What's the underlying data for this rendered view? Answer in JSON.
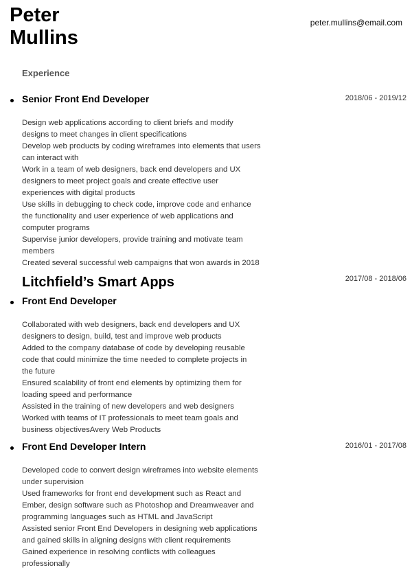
{
  "header": {
    "first_name": "Peter",
    "last_name": "Mullins",
    "email": "peter.mullins@email.com"
  },
  "section_title": "Experience",
  "jobs": [
    {
      "title": "Senior Front End Developer",
      "dates": "2018/06 - 2019/12",
      "lines": [
        "Design web applications according to client briefs and modify",
        "designs to meet changes in client specifications",
        "Develop web products by coding wireframes into elements that users",
        "can interact with",
        "Work in a team of web designers, back end developers and UX",
        "designers to meet project goals and create effective user",
        "experiences with digital products",
        "Use skills in debugging to check code, improve code and enhance",
        "the functionality and user experience of web applications and",
        "computer programs",
        "Supervise junior developers, provide training and motivate team",
        "members",
        "Created several successful web campaigns that won awards in 2018"
      ]
    },
    {
      "company": "Litchfield’s Smart Apps",
      "title": "Front End Developer",
      "dates": "2017/08 - 2018/06",
      "lines": [
        "Collaborated with web designers, back end developers and UX",
        "designers to design, build, test and improve web products",
        "Added to the company database of code by developing reusable",
        "code that could minimize the time needed to complete projects in",
        "the future",
        "Ensured scalability of front end elements by optimizing them for",
        "loading speed and performance",
        "Assisted in the training of new developers and web designers",
        "Worked with teams of IT professionals to meet team goals and",
        "business objectivesAvery Web Products"
      ]
    },
    {
      "title": "Front End Developer Intern",
      "dates": "2016/01 - 2017/08",
      "lines": [
        "Developed code to convert design wireframes into website elements",
        "under supervision",
        "Used frameworks for front end development such as React and",
        "Ember, design software such as Photoshop and Dreamweaver and",
        "programming languages such as HTML and JavaScript",
        "Assisted senior Front End Developers in designing web applications",
        "and gained skills in aligning designs with client requirements",
        "Gained experience in resolving conflicts with colleagues",
        "professionally"
      ]
    }
  ]
}
